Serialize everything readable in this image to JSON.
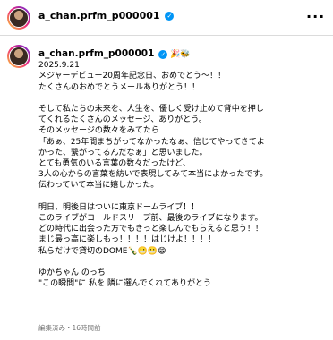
{
  "header": {
    "username": "a_chan.prfm_p000001",
    "verified_icon": "verified-badge-icon",
    "more_icon": "more-options-icon"
  },
  "caption": {
    "username": "a_chan.prfm_p000001",
    "user_emojis": "🎉🐝",
    "date": "2025.9.21",
    "lines": [
      "メジャーデビュー20周年記念日、おめでとう～！！",
      "たくさんのおめでとうメールありがとう！！",
      "",
      "そして私たちの未来を、人生を、優しく受け止めて背中を押し",
      "てくれるたくさんのメッセージ、ありがとう。",
      "そのメッセージの数々をみてたら",
      "「あぁ、25年間まちがってなかったなぁ、信じてやってきてよ",
      "かった、繋がってるんだなぁ」と思いました。",
      "とても勇気のいる言葉の数々だったけど、",
      "3人の心からの言葉を紡いで表現してみて本当によかったです。",
      "伝わっていて本当に嬉しかった。",
      "",
      "明日、明後日はついに東京ドームライブ！！",
      "このライブがコールドスリープ前、最後のライブになります。",
      "どの時代に出会った方でもきっと楽しんでもらえると思う！！",
      "まじ最っ高に楽しもっ！！！！はじけよ！！！！",
      "私らだけで貸切のDOME🍾😬😬😁",
      "",
      "ゆかちゃん のっち",
      "\"この瞬間\"に 私を 隣に選んでくれてありがとう"
    ]
  },
  "meta": {
    "status": "編集済み・16時間前"
  }
}
